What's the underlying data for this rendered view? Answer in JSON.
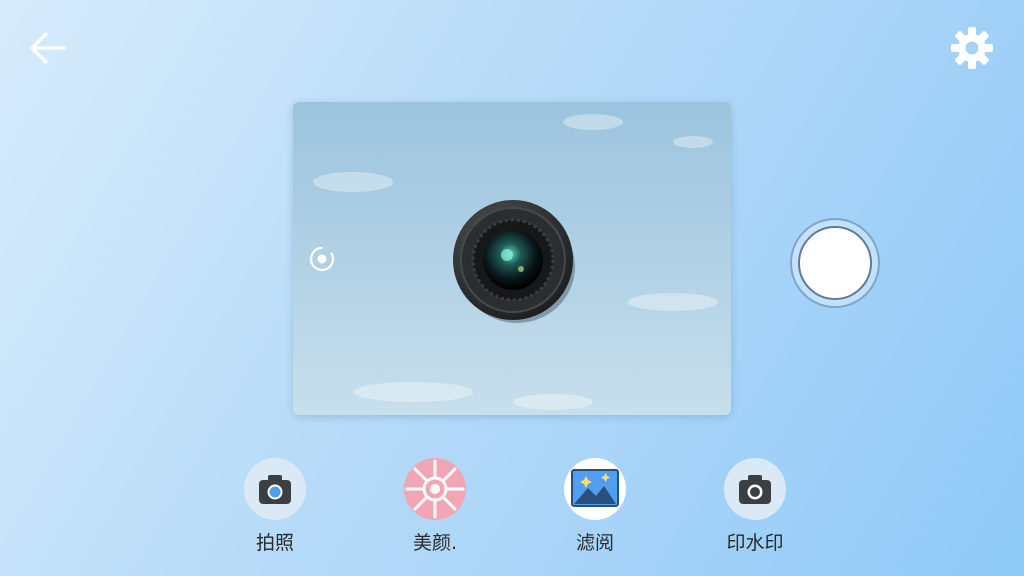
{
  "toolbar": {
    "back_icon": "arrow-left-icon",
    "settings_icon": "gear-icon"
  },
  "preview": {
    "switch_icon": "camera-switch-icon",
    "lens_icon": "camera-lens"
  },
  "shutter": {
    "icon": "shutter-button"
  },
  "modes": [
    {
      "label": "拍照",
      "icon": "camera-icon"
    },
    {
      "label": "美颜.",
      "icon": "beauty-flower-icon"
    },
    {
      "label": "滤阅",
      "icon": "landscape-image-icon"
    },
    {
      "label": "印水印",
      "icon": "camera-icon"
    }
  ],
  "colors": {
    "accent_blue": "#4f9ef0",
    "beauty_pink": "#f2a6b4",
    "icon_dark": "#3b3f44",
    "shutter_ring": "#7fa5c8"
  }
}
